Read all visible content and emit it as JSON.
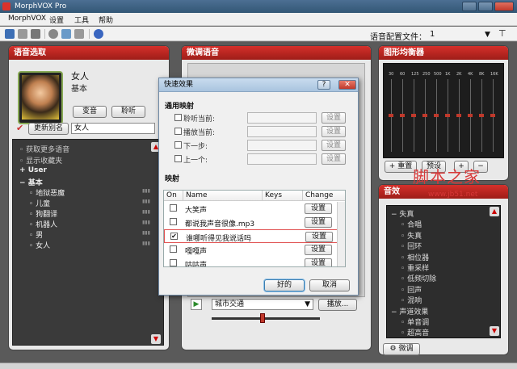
{
  "window": {
    "title": "MorphVOX Pro"
  },
  "menu": [
    "MorphVOX",
    "设置",
    "工具",
    "帮助"
  ],
  "toolbar": {
    "config_label": "语音配置文件：",
    "config_value": "1"
  },
  "voice_panel": {
    "title": "语音选取",
    "voice_name": "女人",
    "voice_sub": "基本",
    "morph_button": "变音",
    "listen_button": "聆听",
    "alias_button": "更新别名",
    "alias_value": "女人",
    "list": [
      {
        "label": "获取更多语音",
        "kind": "link"
      },
      {
        "label": "显示收藏夹",
        "kind": "link"
      },
      {
        "label": "User",
        "kind": "group"
      },
      {
        "label": "基本",
        "kind": "group"
      },
      {
        "label": "地狱恶魔",
        "kind": "item"
      },
      {
        "label": "儿童",
        "kind": "item"
      },
      {
        "label": "狗翻译",
        "kind": "item"
      },
      {
        "label": "机器人",
        "kind": "item"
      },
      {
        "label": "男",
        "kind": "item"
      },
      {
        "label": "女人",
        "kind": "item"
      }
    ]
  },
  "tune_panel": {
    "title": "微调语音",
    "env_value": "城市交通",
    "env_button": "播放..."
  },
  "eq_panel": {
    "title": "图形均衡器",
    "bands": [
      "30",
      "60",
      "125",
      "250",
      "500",
      "1K",
      "2K",
      "4K",
      "8K",
      "16K"
    ],
    "reset_button": "重置",
    "preset_button": "预设"
  },
  "fx_panel": {
    "title": "音效",
    "items": [
      {
        "label": "失真",
        "kind": "group"
      },
      {
        "label": "合唱",
        "kind": "item"
      },
      {
        "label": "失真",
        "kind": "item"
      },
      {
        "label": "回环",
        "kind": "item"
      },
      {
        "label": "相位器",
        "kind": "item"
      },
      {
        "label": "重采样",
        "kind": "item"
      },
      {
        "label": "低频切除",
        "kind": "item"
      },
      {
        "label": "回声",
        "kind": "item"
      },
      {
        "label": "混响",
        "kind": "item"
      },
      {
        "label": "声道效果",
        "kind": "group"
      },
      {
        "label": "单音调",
        "kind": "item"
      },
      {
        "label": "超高音",
        "kind": "item"
      }
    ],
    "tune_button": "微调"
  },
  "dialog": {
    "title": "快速效果",
    "section_general": "通用映射",
    "general_rows": [
      {
        "label": "聆听当前:",
        "button": "设置"
      },
      {
        "label": "播放当前:",
        "button": "设置"
      },
      {
        "label": "下一步:",
        "button": "设置"
      },
      {
        "label": "上一个:",
        "button": "设置"
      }
    ],
    "section_map": "映射",
    "columns": [
      "On",
      "Name",
      "Keys",
      "Change"
    ],
    "rows": [
      {
        "on": false,
        "name": "大笑声",
        "button": "设置"
      },
      {
        "on": false,
        "name": "都说我声音很像.mp3",
        "button": "设置"
      },
      {
        "on": true,
        "name": "谁哪听得见我说话吗",
        "button": "设置"
      },
      {
        "on": false,
        "name": "嘎嘎声",
        "button": "设置"
      },
      {
        "on": false,
        "name": "咕咕声",
        "button": "设置"
      },
      {
        "on": false,
        "name": "鼓声加快拨声",
        "button": "设置"
      }
    ],
    "ok_button": "好的",
    "cancel_button": "取消"
  },
  "watermark": {
    "text": "脚本之家",
    "url": "www.jb51.net"
  }
}
